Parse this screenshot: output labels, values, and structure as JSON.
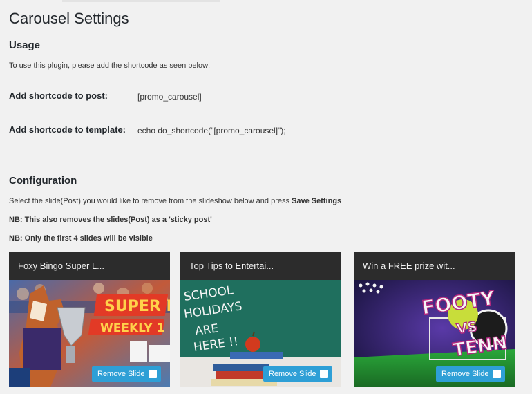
{
  "page": {
    "title": "Carousel Settings"
  },
  "usage": {
    "heading": "Usage",
    "intro": "To use this plugin, please add the shortcode as seen below:",
    "rows": [
      {
        "label": "Add shortcode to post:",
        "value": "[promo_carousel]"
      },
      {
        "label": "Add shortcode to template:",
        "value": "echo do_shortcode(\"[promo_carousel]\");"
      }
    ]
  },
  "configuration": {
    "heading": "Configuration",
    "instruction_pre": "Select the slide(Post) you would like to remove from the slideshow below and press ",
    "instruction_bold": "Save Settings",
    "note1": "NB: This also removes the slides(Post) as a 'sticky post'",
    "note2": "NB: Only the first 4 slides will be visible"
  },
  "slides": [
    {
      "title": "Foxy Bingo Super L...",
      "image_text": [
        "SUPER L",
        "WEEKLY 1"
      ],
      "button_label": "Remove Slide",
      "checked": false
    },
    {
      "title": "Top Tips to Entertai...",
      "image_text": [
        "SCHOOL",
        "HOLIDAYS",
        "ARE",
        "HERE !!"
      ],
      "button_label": "Remove Slide",
      "checked": false
    },
    {
      "title": "Win a FREE prize wit...",
      "image_text": [
        "FOOTY",
        "VS",
        "TENN"
      ],
      "button_label": "Remove Slide",
      "checked": false
    }
  ],
  "colors": {
    "background": "#f1f1f1",
    "card_header": "#2c2c2c",
    "button": "#2e9fd6",
    "chalkboard": "#1f6f5e"
  }
}
